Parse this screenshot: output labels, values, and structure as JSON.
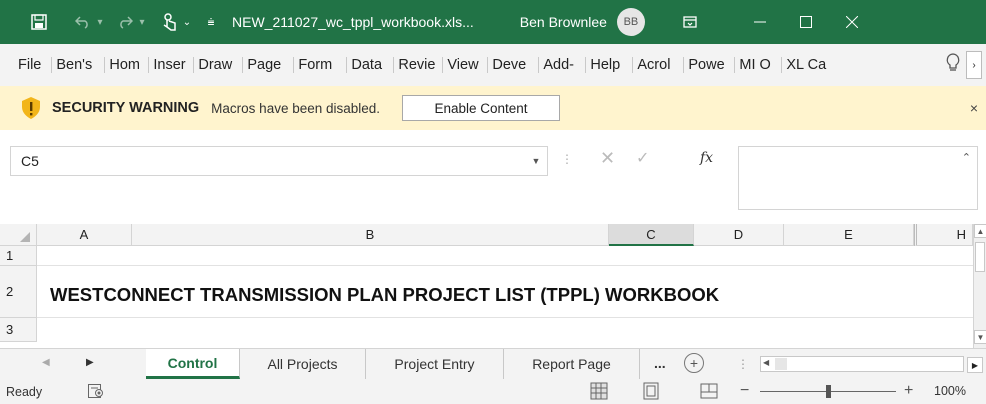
{
  "colors": {
    "excel_green": "#217346",
    "warning_bg": "#fff4ce",
    "grid_line": "#e2e2e2"
  },
  "titlebar": {
    "document_title": "NEW_211027_wc_tppl_workbook.xls...",
    "user_name": "Ben Brownlee",
    "user_initials": "BB",
    "icons": [
      "save-icon",
      "undo-icon",
      "redo-icon",
      "touch-mode-icon",
      "customize-quick-access-icon",
      "ribbon-display-options-icon",
      "minimize-icon",
      "maximize-icon",
      "close-icon"
    ]
  },
  "menu": {
    "file": "File",
    "tabs": [
      "Ben's",
      "Hom",
      "Inser",
      "Draw",
      "Page",
      "Form",
      "Data",
      "Revie",
      "View",
      "Deve",
      "Add-",
      "Help",
      "Acrol",
      "Powe",
      "MI O",
      "XL Ca"
    ]
  },
  "security": {
    "title": "SECURITY WARNING",
    "message": "Macros have been disabled.",
    "button": "Enable Content",
    "close": "×"
  },
  "formula_bar": {
    "name_box": "C5",
    "fx_label": "fx",
    "cancel": "✕",
    "enter": "✓",
    "value": ""
  },
  "grid": {
    "columns": [
      "A",
      "B",
      "C",
      "D",
      "E",
      "H"
    ],
    "selected_column": "C",
    "rows": [
      "1",
      "2",
      "3"
    ],
    "title_text": "WESTCONNECT TRANSMISSION PLAN PROJECT LIST (TPPL) WORKBOOK"
  },
  "sheets": {
    "tabs": [
      "Control",
      "All Projects",
      "Project Entry",
      "Report Page"
    ],
    "active": "Control",
    "more": "...",
    "add": "+"
  },
  "status": {
    "ready": "Ready",
    "zoom": "100%",
    "zoom_minus": "−",
    "zoom_plus": "+"
  }
}
